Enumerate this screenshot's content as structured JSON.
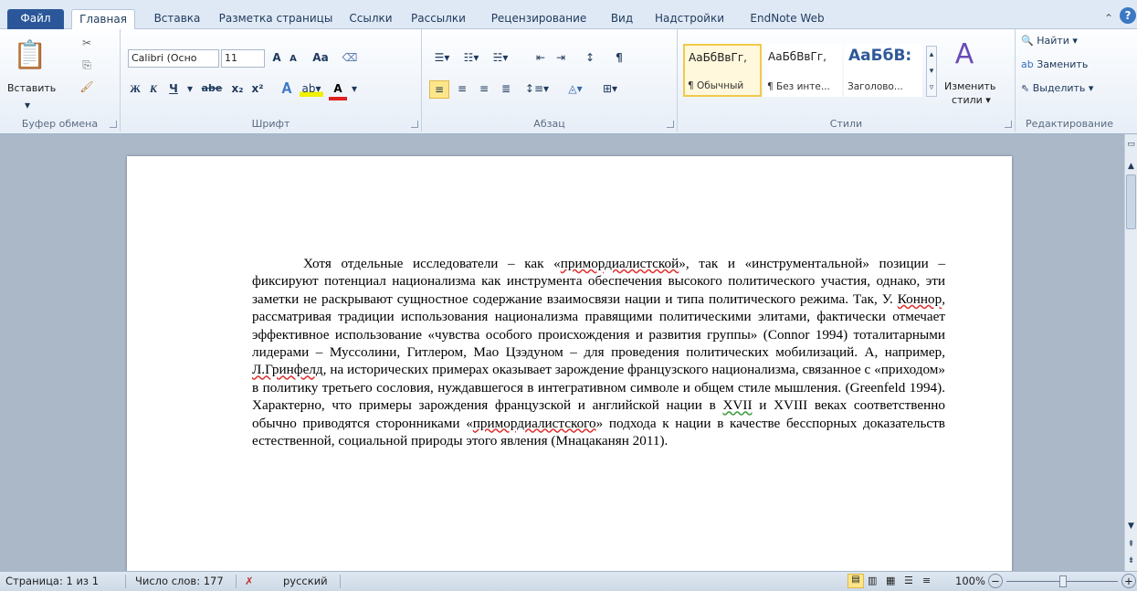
{
  "tabs": [
    "Файл",
    "Главная",
    "Вставка",
    "Разметка страницы",
    "Ссылки",
    "Рассылки",
    "Рецензирование",
    "Вид",
    "Надстройки",
    "EndNote Web"
  ],
  "clipboard": {
    "paste_label": "Вставить",
    "group_label": "Буфер обмена"
  },
  "font": {
    "name": "Calibri (Осно",
    "size": "11",
    "group_label": "Шрифт",
    "bold": "Ж",
    "italic": "К",
    "underline": "Ч",
    "strike": "abe",
    "subscript": "x₂",
    "superscript": "x²",
    "grow": "A",
    "shrink": "A",
    "case": "Aa",
    "color_a": "A"
  },
  "paragraph": {
    "group_label": "Абзац"
  },
  "styles": {
    "items": [
      {
        "sample": "АаБбВвГг,",
        "label": "¶ Обычный"
      },
      {
        "sample": "АаБбВвГг,",
        "label": "¶ Без инте..."
      },
      {
        "sample": "АаБбВ:",
        "label": "Заголово..."
      }
    ],
    "change_label": "Изменить",
    "change_label2": "стили ▾",
    "group_label": "Стили"
  },
  "editing": {
    "find": "Найти ▾",
    "replace": "Заменить",
    "select": "Выделить ▾",
    "group_label": "Редактирование"
  },
  "document": {
    "p1": "Хотя отдельные исследователи – как «",
    "w1": "примордиалистской",
    "p2": "», так и «инструментальной» позиции – фиксируют потенциал национализма как инструмента обеспечения высокого политического участия, однако, эти заметки не раскрывают сущностное содержание взаимосвязи нации и типа политического режима. Так, У. ",
    "w2": "Коннор",
    "p3": ", рассматривая традиции использования национализма правящими политическими элитами, фактически отмечает эффективное использование «чувства особого происхождения и развития группы» (Connor 1994) тоталитарными лидерами – Муссолини, Гитлером, Мао Цзэдуном – для проведения политических мобилизаций. А, например, ",
    "w3": "Л.Гринфелд",
    "p4": ", на исторических примерах оказывает зарождение французского национализма, связанное с «приходом» в политику третьего сословия, нуждавшегося в интегративном символе и общем стиле мышления. (Greenfeld 1994). Характерно, что примеры зарождения французской и английской нации в ",
    "w4": "XVII",
    "p5": " и XVIII веках соответственно обычно приводятся сторонниками «",
    "w5": "примордиалистского",
    "p6": "» подхода к нации в качестве бесспорных доказательств естественной, социальной природы этого явления (Мнацаканян 2011)."
  },
  "status": {
    "page": "Страница: 1 из 1",
    "words": "Число слов: 177",
    "lang": "русский",
    "zoom": "100%"
  }
}
